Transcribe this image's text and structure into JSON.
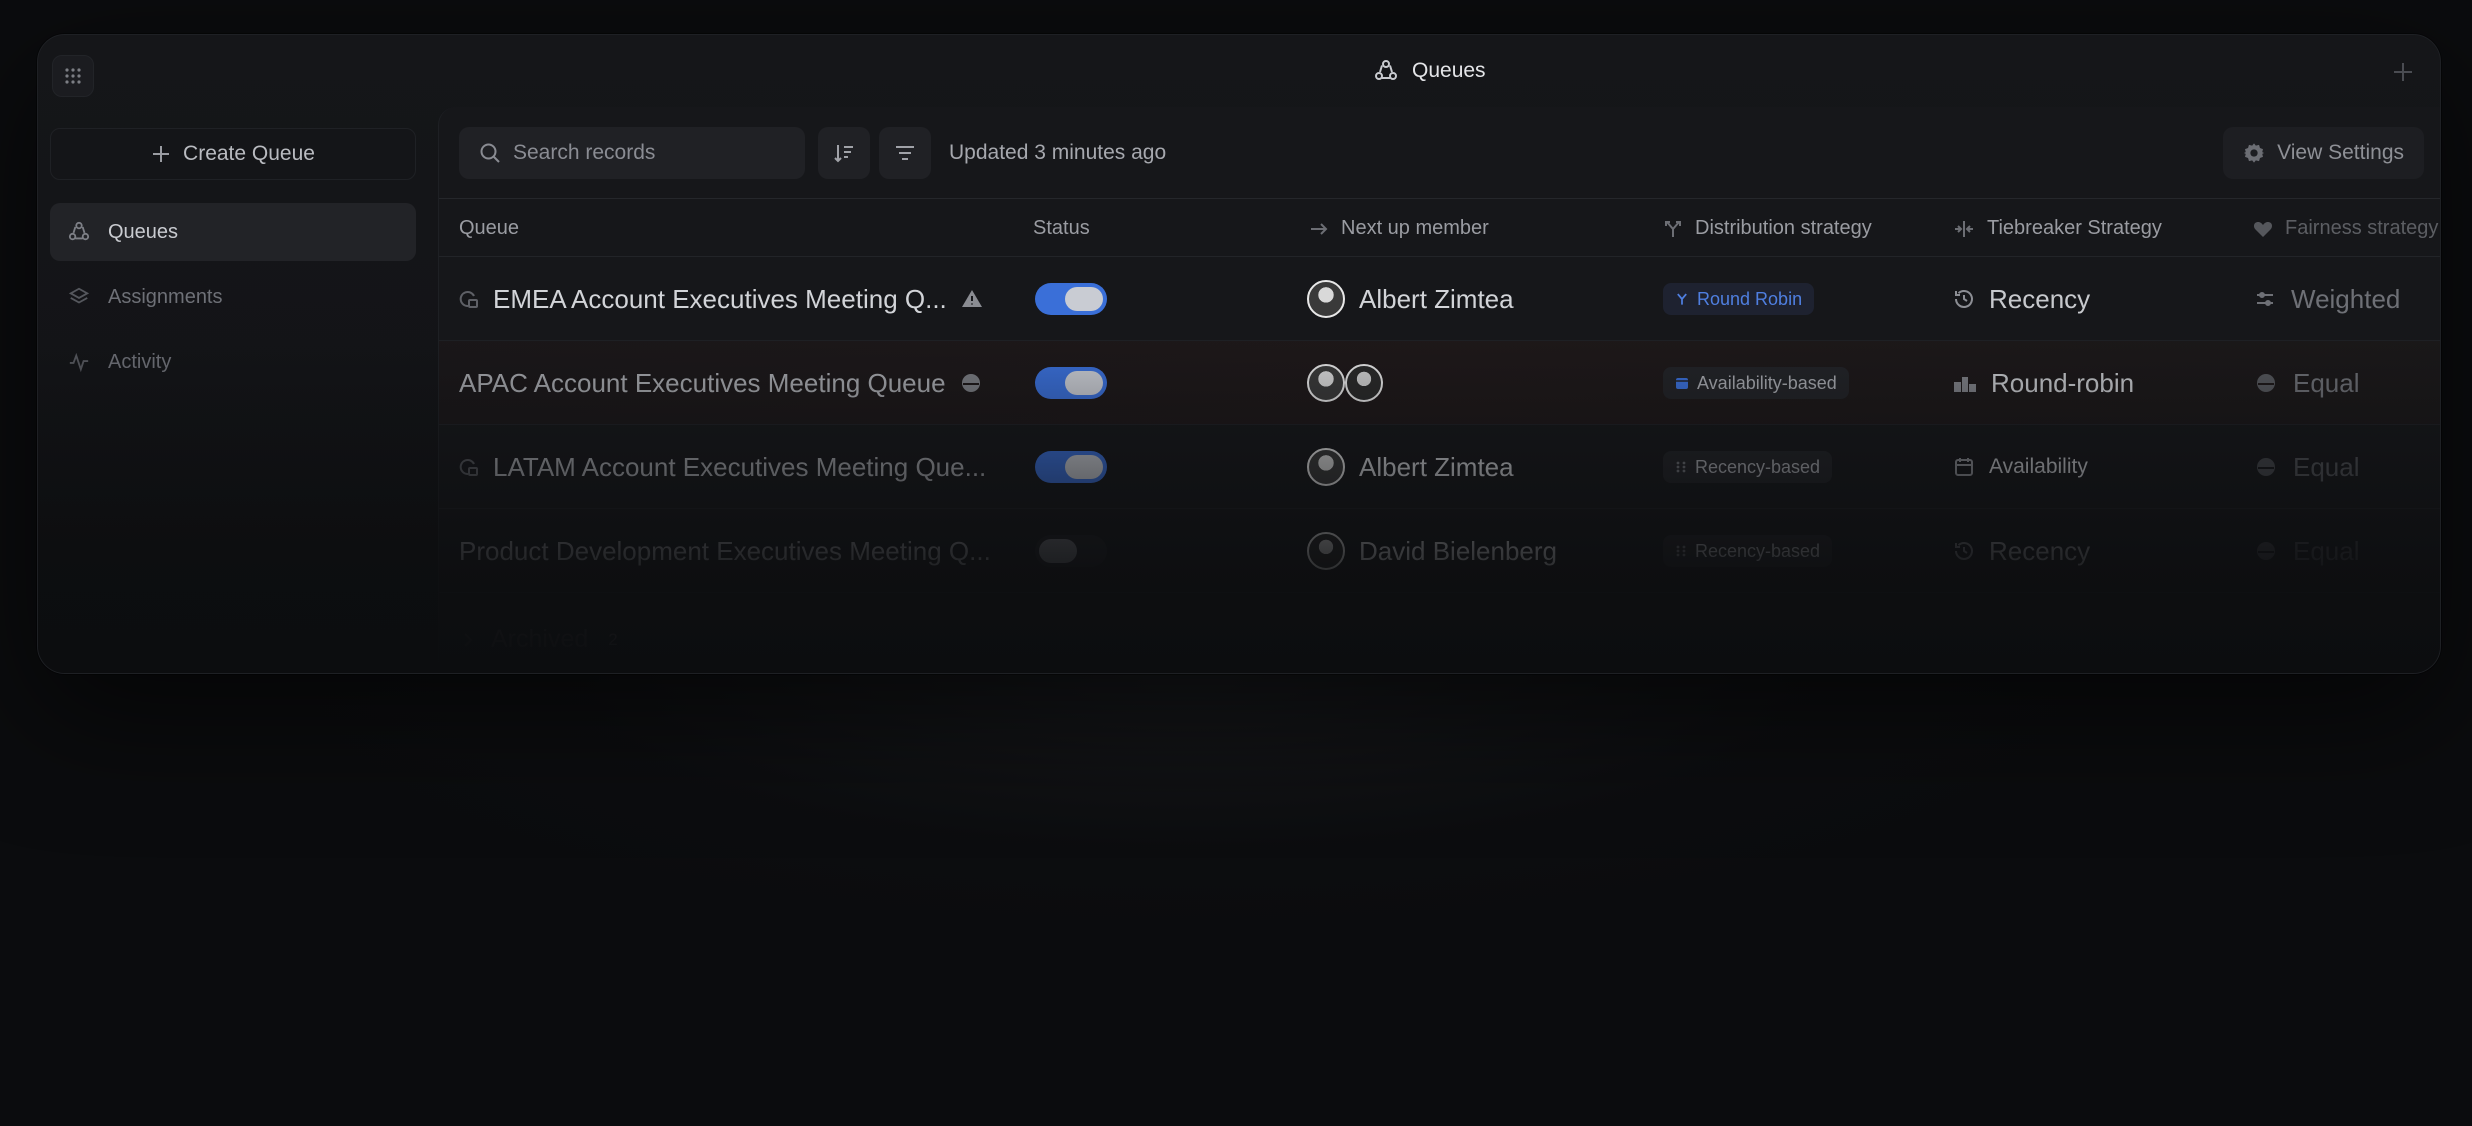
{
  "window": {
    "title": "Queues",
    "title_icon": "queues-icon"
  },
  "sidebar": {
    "create_button": "Create Queue",
    "items": [
      {
        "label": "Queues",
        "icon": "queues-icon",
        "active": true
      },
      {
        "label": "Assignments",
        "icon": "layers-icon",
        "active": false
      },
      {
        "label": "Activity",
        "icon": "activity-icon",
        "active": false
      }
    ]
  },
  "toolbar": {
    "search_placeholder": "Search records",
    "updated_text": "Updated 3 minutes ago",
    "view_settings": "View Settings"
  },
  "table": {
    "columns": {
      "queue": "Queue",
      "status": "Status",
      "next_up": "Next up member",
      "distribution": "Distribution strategy",
      "tiebreaker": "Tiebreaker Strategy",
      "fairness": "Fairness strategy"
    },
    "rows": [
      {
        "queue": "EMEA Account Executives Meeting Q...",
        "status_on": true,
        "member": "Albert Zimtea",
        "distribution": "Round Robin",
        "tiebreaker": "Recency",
        "fairness": "Weighted"
      },
      {
        "queue": "APAC Account Executives Meeting Queue",
        "status_on": true,
        "member": "",
        "distribution": "Availability-based",
        "tiebreaker": "Round-robin",
        "fairness": "Equal"
      },
      {
        "queue": "LATAM Account Executives Meeting Que...",
        "status_on": true,
        "member": "Albert Zimtea",
        "distribution": "Recency-based",
        "tiebreaker": "Availability",
        "fairness": "Equal"
      },
      {
        "queue": "Product Development Executives Meeting Q...",
        "status_on": false,
        "member": "David Bielenberg",
        "distribution": "Recency-based",
        "tiebreaker": "Recency",
        "fairness": "Equal"
      }
    ],
    "archived_label": "Archived",
    "archived_count": "2"
  },
  "colors": {
    "accent": "#3a6fd8",
    "background": "#0b0c0e",
    "panel": "#16171a"
  }
}
